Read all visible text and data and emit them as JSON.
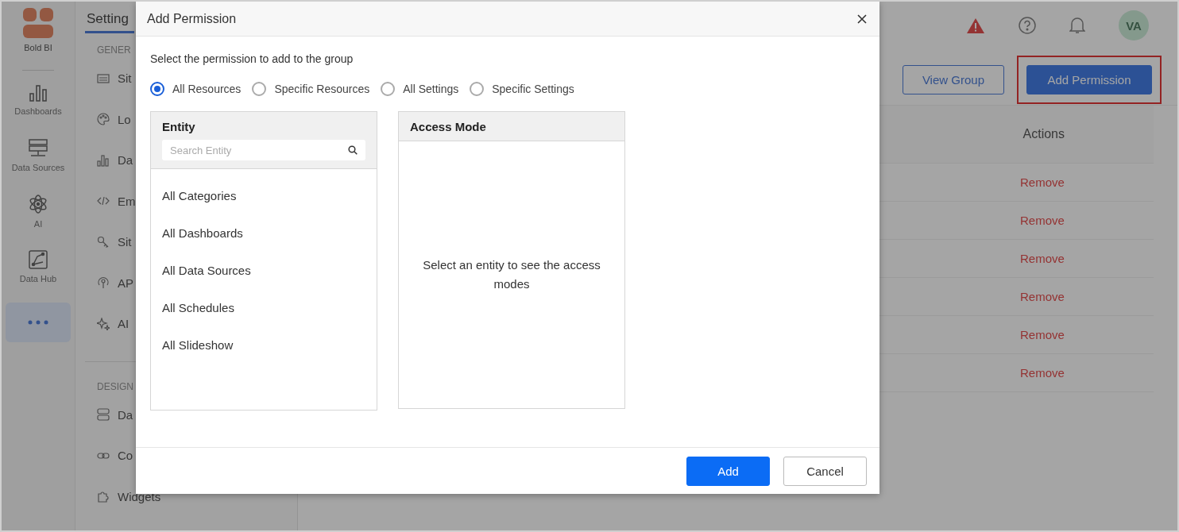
{
  "sidebar": {
    "logo_text": "Bold BI",
    "items": [
      {
        "kind": "chart",
        "label": "Dashboards",
        "selected": false
      },
      {
        "kind": "server",
        "label": "Data Sources",
        "selected": false
      },
      {
        "kind": "atom",
        "label": "AI",
        "selected": false
      },
      {
        "kind": "hub",
        "label": "Data Hub",
        "selected": false
      },
      {
        "kind": "more",
        "selected": true
      }
    ]
  },
  "settings_panel": {
    "title": "Setting",
    "sections": [
      {
        "heading": "GENER",
        "items": [
          {
            "kind": "url",
            "label": "Sit"
          },
          {
            "kind": "palette",
            "label": "Lo"
          },
          {
            "kind": "chart",
            "label": "Da"
          },
          {
            "kind": "code",
            "label": "Em"
          },
          {
            "kind": "key",
            "label": "Sit"
          },
          {
            "kind": "api",
            "label": "AP"
          },
          {
            "kind": "sparkle",
            "label": "AI"
          }
        ]
      },
      {
        "heading": "DESIGN",
        "items": [
          {
            "kind": "layout",
            "label": "Da"
          },
          {
            "kind": "link",
            "label": "Co"
          },
          {
            "kind": "puzzle",
            "label": "Widgets"
          }
        ]
      }
    ]
  },
  "header": {
    "avatar": "VA"
  },
  "toolbar": {
    "buttons": [
      {
        "kind": "outline",
        "label": "View Group",
        "highlighted": false
      },
      {
        "kind": "primary",
        "label": "Add Permission",
        "highlighted": true
      }
    ]
  },
  "table": {
    "columns": [
      {
        "label": "Actions"
      }
    ],
    "rows": [
      {
        "action": "Remove"
      },
      {
        "action": "Remove"
      },
      {
        "action": "Remove"
      },
      {
        "action": "Remove"
      },
      {
        "action": "Remove"
      },
      {
        "action": "Remove"
      }
    ]
  },
  "dialog": {
    "title": "Add Permission",
    "prompt": "Select the permission to add to the group",
    "options": [
      {
        "label": "All Resources",
        "selected": true
      },
      {
        "label": "Specific Resources",
        "selected": false
      },
      {
        "label": "All Settings",
        "selected": false
      },
      {
        "label": "Specific Settings",
        "selected": false
      }
    ],
    "entity_panel": {
      "title": "Entity",
      "search": {
        "placeholder": "Search Entity"
      },
      "items": [
        "All Categories",
        "All Dashboards",
        "All Data Sources",
        "All Schedules",
        "All Slideshow"
      ]
    },
    "access_panel": {
      "title": "Access Mode",
      "empty_message": "Select an entity to see the access modes"
    },
    "buttons": [
      {
        "kind": "primary",
        "label": "Add"
      },
      {
        "kind": "secondary",
        "label": "Cancel"
      }
    ]
  }
}
